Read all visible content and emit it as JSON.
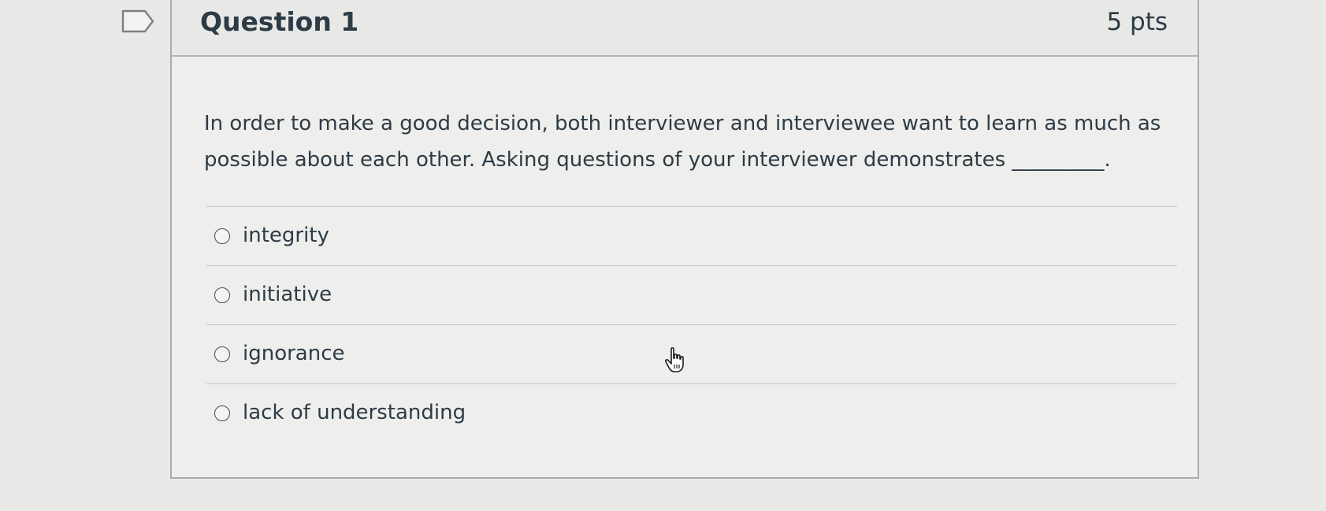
{
  "question": {
    "title": "Question 1",
    "points": "5 pts",
    "text": "In order to make a good decision, both interviewer and interviewee want to learn as much as possible about each other. Asking questions of your interviewer demonstrates _________."
  },
  "answers": [
    {
      "label": "integrity",
      "selected": false
    },
    {
      "label": "initiative",
      "selected": false
    },
    {
      "label": "ignorance",
      "selected": false
    },
    {
      "label": "lack of understanding",
      "selected": false
    }
  ],
  "icons": {
    "bookmark": "bookmark-flag-icon",
    "cursor": "hand-pointer-cursor-icon",
    "radio": "radio-unselected-icon"
  },
  "colors": {
    "background": "#e9e9e7",
    "text": "#2d3b45",
    "border": "#a9acac"
  }
}
